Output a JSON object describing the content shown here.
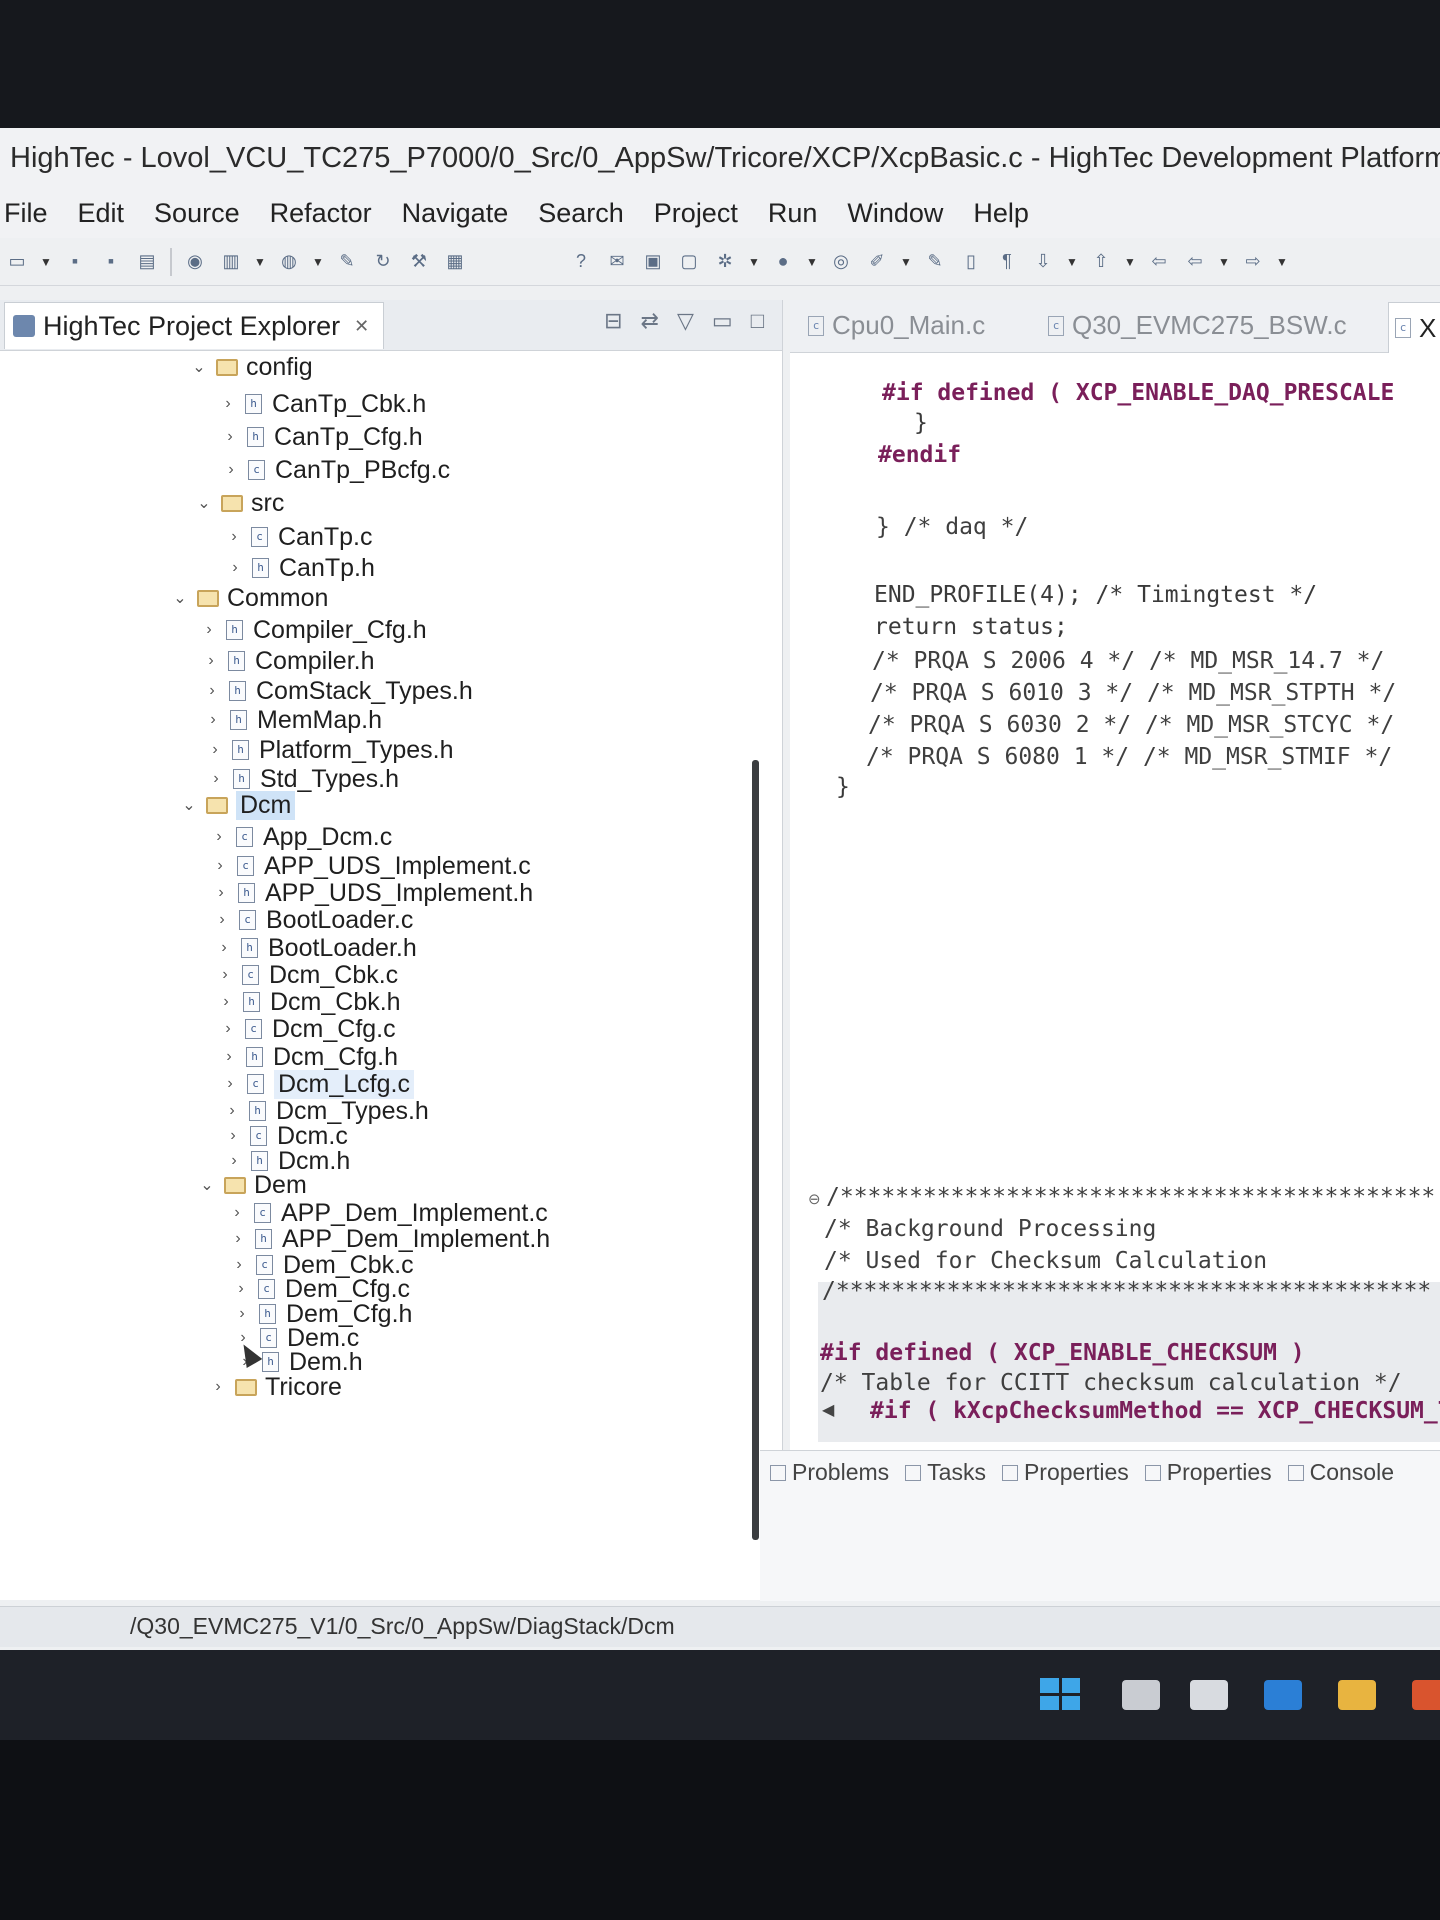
{
  "window": {
    "title": "HighTec - Lovol_VCU_TC275_P7000/0_Src/0_AppSw/Tricore/XCP/XcpBasic.c - HighTec Development Platform Run"
  },
  "menu": [
    "File",
    "Edit",
    "Source",
    "Refactor",
    "Navigate",
    "Search",
    "Project",
    "Run",
    "Window",
    "Help"
  ],
  "explorer": {
    "tab_label": "HighTec Project Explorer",
    "tree": [
      {
        "label": "config",
        "kind": "folder",
        "expanded": true
      },
      {
        "label": "CanTp_Cbk.h",
        "kind": "h"
      },
      {
        "label": "CanTp_Cfg.h",
        "kind": "h"
      },
      {
        "label": "CanTp_PBcfg.c",
        "kind": "c"
      },
      {
        "label": "src",
        "kind": "folder",
        "expanded": true
      },
      {
        "label": "CanTp.c",
        "kind": "c"
      },
      {
        "label": "CanTp.h",
        "kind": "h"
      },
      {
        "label": "Common",
        "kind": "folder",
        "expanded": true
      },
      {
        "label": "Compiler_Cfg.h",
        "kind": "h"
      },
      {
        "label": "Compiler.h",
        "kind": "h"
      },
      {
        "label": "ComStack_Types.h",
        "kind": "h"
      },
      {
        "label": "MemMap.h",
        "kind": "h"
      },
      {
        "label": "Platform_Types.h",
        "kind": "h"
      },
      {
        "label": "Std_Types.h",
        "kind": "h"
      },
      {
        "label": "Dcm",
        "kind": "folder",
        "expanded": true,
        "selected": true
      },
      {
        "label": "App_Dcm.c",
        "kind": "c"
      },
      {
        "label": "APP_UDS_Implement.c",
        "kind": "c"
      },
      {
        "label": "APP_UDS_Implement.h",
        "kind": "h"
      },
      {
        "label": "BootLoader.c",
        "kind": "c"
      },
      {
        "label": "BootLoader.h",
        "kind": "h"
      },
      {
        "label": "Dcm_Cbk.c",
        "kind": "c"
      },
      {
        "label": "Dcm_Cbk.h",
        "kind": "h"
      },
      {
        "label": "Dcm_Cfg.c",
        "kind": "c"
      },
      {
        "label": "Dcm_Cfg.h",
        "kind": "h"
      },
      {
        "label": "Dcm_Lcfg.c",
        "kind": "c",
        "hover": true
      },
      {
        "label": "Dcm_Types.h",
        "kind": "h"
      },
      {
        "label": "Dcm.c",
        "kind": "c"
      },
      {
        "label": "Dcm.h",
        "kind": "h"
      },
      {
        "label": "Dem",
        "kind": "folder",
        "expanded": true
      },
      {
        "label": "APP_Dem_Implement.c",
        "kind": "c"
      },
      {
        "label": "APP_Dem_Implement.h",
        "kind": "h"
      },
      {
        "label": "Dem_Cbk.c",
        "kind": "c"
      },
      {
        "label": "Dem_Cfg.c",
        "kind": "c"
      },
      {
        "label": "Dem_Cfg.h",
        "kind": "h"
      },
      {
        "label": "Dem.c",
        "kind": "c"
      },
      {
        "label": "Dem.h",
        "kind": "h"
      },
      {
        "label": "Tricore",
        "kind": "folder",
        "expanded": false
      }
    ]
  },
  "status_path": "/Q30_EVMC275_V1/0_Src/0_AppSw/DiagStack/Dcm",
  "editor": {
    "tabs": [
      "Cpu0_Main.c",
      "Q30_EVMC275_BSW.c",
      "X"
    ],
    "lines": [
      "#if defined ( XCP_ENABLE_DAQ_PRESCALE",
      "}",
      "#endif",
      "} /* daq */",
      "END_PROFILE(4); /* Timingtest */",
      "return status;",
      "/* PRQA S 2006 4 */ /* MD_MSR_14.7 */",
      "/* PRQA S 6010 3 */ /* MD_MSR_STPTH */",
      "/* PRQA S 6030 2 */ /* MD_MSR_STCYC */",
      "/* PRQA S 6080 1 */ /* MD_MSR_STMIF */",
      "}",
      "/*******************************************",
      "/* Background Processing",
      "/* Used for Checksum Calculation",
      "/*******************************************",
      "#if defined ( XCP_ENABLE_CHECKSUM )",
      "/* Table for CCITT checksum calculation */",
      "#if ( kXcpChecksumMethod == XCP_CHECKSUM_TY"
    ]
  },
  "views": {
    "tabs": [
      "Problems",
      "Tasks",
      "Properties",
      "Properties",
      "Console"
    ]
  }
}
